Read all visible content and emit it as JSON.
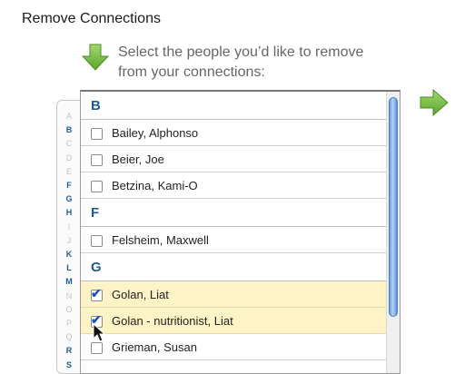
{
  "page": {
    "title": "Remove Connections",
    "instructions": "Select the people you’d like to remove from your connections:"
  },
  "alphabet": [
    {
      "letter": "A",
      "active": false
    },
    {
      "letter": "B",
      "active": true
    },
    {
      "letter": "C",
      "active": false
    },
    {
      "letter": "D",
      "active": false
    },
    {
      "letter": "E",
      "active": false
    },
    {
      "letter": "F",
      "active": true
    },
    {
      "letter": "G",
      "active": true
    },
    {
      "letter": "H",
      "active": true
    },
    {
      "letter": "I",
      "active": false
    },
    {
      "letter": "J",
      "active": false
    },
    {
      "letter": "K",
      "active": true
    },
    {
      "letter": "L",
      "active": true
    },
    {
      "letter": "M",
      "active": true
    },
    {
      "letter": "N",
      "active": false
    },
    {
      "letter": "O",
      "active": false
    },
    {
      "letter": "P",
      "active": false
    },
    {
      "letter": "Q",
      "active": false
    },
    {
      "letter": "R",
      "active": true
    },
    {
      "letter": "S",
      "active": true
    }
  ],
  "list": [
    {
      "type": "header",
      "label": "B"
    },
    {
      "type": "person",
      "name": "Bailey, Alphonso",
      "checked": false
    },
    {
      "type": "person",
      "name": "Beier, Joe",
      "checked": false
    },
    {
      "type": "person",
      "name": "Betzina, Kami-O",
      "checked": false
    },
    {
      "type": "header",
      "label": "F"
    },
    {
      "type": "person",
      "name": "Felsheim, Maxwell",
      "checked": false
    },
    {
      "type": "header",
      "label": "G"
    },
    {
      "type": "person",
      "name": "Golan, Liat",
      "checked": true
    },
    {
      "type": "person",
      "name": "Golan - nutritionist, Liat",
      "checked": true
    },
    {
      "type": "person",
      "name": "Grieman, Susan",
      "checked": false
    }
  ],
  "icons": {
    "step_arrow_down": "arrow-down-icon",
    "next_arrow": "arrow-right-icon",
    "checkmark": "checkmark-icon",
    "cursor": "mouse-pointer-icon"
  },
  "colors": {
    "accent_green": "#76c043",
    "section_header": "#1d5e95",
    "selected_row": "#fdf3c5",
    "instruction_text": "#666666"
  }
}
